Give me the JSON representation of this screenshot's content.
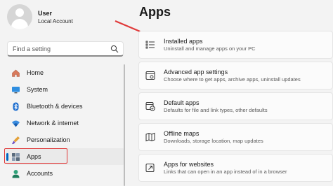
{
  "account": {
    "name": "User",
    "type": "Local Account"
  },
  "search": {
    "placeholder": "Find a setting"
  },
  "nav": {
    "items": [
      {
        "label": "Home",
        "icon": "home-icon"
      },
      {
        "label": "System",
        "icon": "monitor-icon"
      },
      {
        "label": "Bluetooth & devices",
        "icon": "bluetooth-icon"
      },
      {
        "label": "Network & internet",
        "icon": "wifi-icon"
      },
      {
        "label": "Personalization",
        "icon": "paintbrush-icon"
      },
      {
        "label": "Apps",
        "icon": "apps-icon",
        "selected": true
      },
      {
        "label": "Accounts",
        "icon": "account-icon"
      }
    ]
  },
  "page": {
    "title": "Apps"
  },
  "cards": [
    {
      "title": "Installed apps",
      "description": "Uninstall and manage apps on your PC",
      "icon": "list-icon"
    },
    {
      "title": "Advanced app settings",
      "description": "Choose where to get apps, archive apps, uninstall updates",
      "icon": "app-settings-icon"
    },
    {
      "title": "Default apps",
      "description": "Defaults for file and link types, other defaults",
      "icon": "default-apps-icon"
    },
    {
      "title": "Offline maps",
      "description": "Downloads, storage location, map updates",
      "icon": "map-icon"
    },
    {
      "title": "Apps for websites",
      "description": "Links that can open in an app instead of in a browser",
      "icon": "open-link-icon"
    }
  ],
  "colors": {
    "accent": "#0067c0",
    "annotation": "#e03a3a",
    "background": "#f3f3f3"
  }
}
